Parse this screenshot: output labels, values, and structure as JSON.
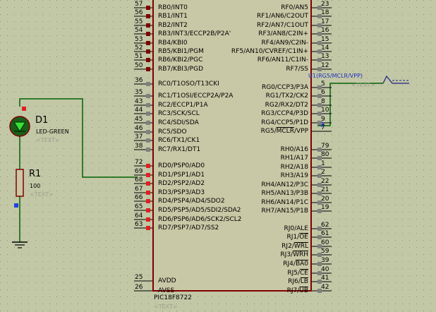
{
  "chip": {
    "part_name": "PIC18F8722",
    "text_placeholder": "<TEXT>",
    "left_pins": [
      {
        "num": "57",
        "label": "RB0/INT0",
        "sq": "#800000"
      },
      {
        "num": "56",
        "label": "RB1/INT1",
        "sq": "#800000"
      },
      {
        "num": "55",
        "label": "RB2/INT2",
        "sq": "#800000"
      },
      {
        "num": "54",
        "label": "RB3/INT3/ECCP2B/P2A'",
        "sq": "#800000"
      },
      {
        "num": "53",
        "label": "RB4/KBI0",
        "sq": "#800000"
      },
      {
        "num": "52",
        "label": "RB5/KBI1/PGM",
        "sq": "#800000"
      },
      {
        "num": "51",
        "label": "RB6/KBI2/PGC",
        "sq": "#800000"
      },
      {
        "num": "50",
        "label": "RB7/KBI3/PGD",
        "sq": "#800000"
      },
      {
        "num": "36",
        "label": "RC0/T1OSO/T13CKI",
        "sq": "#808080"
      },
      {
        "num": "35",
        "label": "RC1/T1OSI/ECCP2A/P2A",
        "sq": "#808080"
      },
      {
        "num": "43",
        "label": "RC2/ECCP1/P1A",
        "sq": "#808080"
      },
      {
        "num": "44",
        "label": "RC3/SCK/SCL",
        "sq": "#808080"
      },
      {
        "num": "45",
        "label": "RC4/SDI/SDA",
        "sq": "#808080"
      },
      {
        "num": "46",
        "label": "RC5/SDO",
        "sq": "#808080"
      },
      {
        "num": "37",
        "label": "RC6/TX1/CK1",
        "sq": "#808080"
      },
      {
        "num": "38",
        "label": "RC7/RX1/DT1",
        "sq": "#808080"
      },
      {
        "num": "72",
        "label": "RD0/PSP0/AD0",
        "sq": "#e02020"
      },
      {
        "num": "69",
        "label": "RD1/PSP1/AD1",
        "sq": "#e02020"
      },
      {
        "num": "68",
        "label": "RD2/PSP2/AD2",
        "sq": "#e02020"
      },
      {
        "num": "67",
        "label": "RD3/PSP3/AD3",
        "sq": "#e02020"
      },
      {
        "num": "66",
        "label": "RD4/PSP4/AD4/SDO2",
        "sq": "#e02020"
      },
      {
        "num": "65",
        "label": "RD5/PSP5/AD5/SDI2/SDA2",
        "sq": "#e02020"
      },
      {
        "num": "64",
        "label": "RD6/PSP6/AD6/SCK2/SCL2",
        "sq": "#e02020"
      },
      {
        "num": "63",
        "label": "RD7/PSP7/AD7/SS2",
        "sq": "#e02020"
      },
      {
        "num": "25",
        "label": "AVDD",
        "sq": ""
      },
      {
        "num": "26",
        "label": "AVSS",
        "sq": ""
      }
    ],
    "right_pins": [
      {
        "num": "23",
        "label": "RF0/AN5",
        "sq": "#808080"
      },
      {
        "num": "18",
        "label": "RF1/AN6/C2OUT",
        "sq": "#808080"
      },
      {
        "num": "17",
        "label": "RF2/AN7/C1OUT",
        "sq": "#808080"
      },
      {
        "num": "16",
        "label": "RF3/AN8/C2IN+",
        "sq": "#808080"
      },
      {
        "num": "15",
        "label": "RF4/AN9/C2IN-",
        "sq": "#808080"
      },
      {
        "num": "14",
        "label": "RF5/AN10/CVREF/C1IN+",
        "sq": "#808080"
      },
      {
        "num": "13",
        "label": "RF6/AN11/C1IN-",
        "sq": "#808080"
      },
      {
        "num": "12",
        "label": "RF7/SS",
        "sq": "#808080"
      },
      {
        "num": "5",
        "label": "RG0/CCP3/P3A",
        "sq": "#808080"
      },
      {
        "num": "6",
        "label": "RG1/TX2/CK2",
        "sq": "#808080"
      },
      {
        "num": "8",
        "label": "RG2/RX2/DT2",
        "sq": "#808080"
      },
      {
        "num": "10",
        "label": "RG3/CCP4/P3D",
        "sq": "#808080"
      },
      {
        "num": "9",
        "label": "RG4/CCP5/P1D",
        "sq": "#808080"
      },
      {
        "num": "7",
        "label": "RG5/MCLR/VPP",
        "sq": ""
      },
      {
        "num": "79",
        "label": "RH0/A16",
        "sq": "#808080"
      },
      {
        "num": "80",
        "label": "RH1/A17",
        "sq": "#808080"
      },
      {
        "num": "1",
        "label": "RH2/A18",
        "sq": "#808080"
      },
      {
        "num": "2",
        "label": "RH3/A19",
        "sq": "#808080"
      },
      {
        "num": "22",
        "label": "RH4/AN12/P3C",
        "sq": "#808080"
      },
      {
        "num": "21",
        "label": "RH5/AN13/P3B",
        "sq": "#808080"
      },
      {
        "num": "20",
        "label": "RH6/AN14/P1C",
        "sq": "#808080"
      },
      {
        "num": "19",
        "label": "RH7/AN15/P1B",
        "sq": "#808080"
      },
      {
        "num": "62",
        "label": "RJ0/ALE",
        "sq": "#808080"
      },
      {
        "num": "61",
        "label": "RJ1/OE",
        "sq": "#808080"
      },
      {
        "num": "60",
        "label": "RJ2/WRL",
        "sq": "#808080"
      },
      {
        "num": "59",
        "label": "RJ3/WRH",
        "sq": "#808080"
      },
      {
        "num": "39",
        "label": "RJ4/BA0",
        "sq": "#808080"
      },
      {
        "num": "40",
        "label": "RJ5/CE",
        "sq": "#808080"
      },
      {
        "num": "41",
        "label": "RJ6/LB",
        "sq": "#808080"
      },
      {
        "num": "42",
        "label": "RJ7/UB",
        "sq": "#808080"
      }
    ]
  },
  "led": {
    "ref": "D1",
    "value": "LED-GREEN",
    "text": "<TEXT>",
    "color": "#10a010"
  },
  "resistor": {
    "ref": "R1",
    "value": "100",
    "text": "<TEXT>"
  },
  "terminal": {
    "label": "U1(RG5/MCLR/VPP)",
    "text": "<TEXT>"
  },
  "colors": {
    "wire": "#006400",
    "body": "#800000",
    "grid": "#bdbfa0"
  }
}
